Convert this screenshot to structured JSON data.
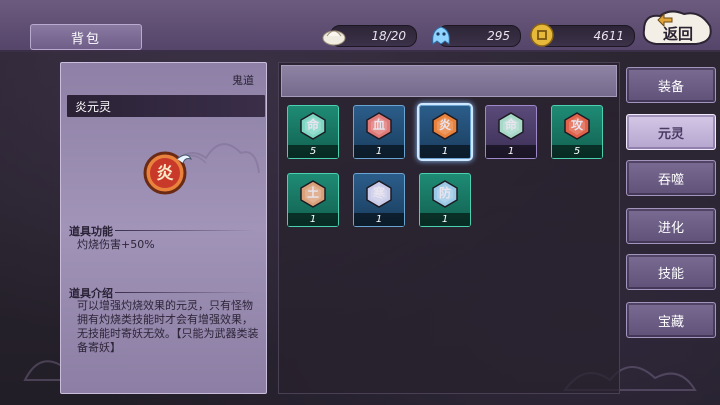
{
  "header": {
    "title": "背包",
    "resources": [
      {
        "name": "bun-icon",
        "value": "18/20"
      },
      {
        "name": "ghost-spirit-icon",
        "value": "295"
      },
      {
        "name": "gold-coin-icon",
        "value": "4611"
      }
    ],
    "back_label": "返回"
  },
  "detail": {
    "category": "鬼道",
    "item_name": "炎元灵",
    "item_glyph": "炎",
    "function_title": "道具功能",
    "function_text": "灼烧伤害+50%",
    "intro_title": "道具介绍",
    "intro_text": "可以增强灼烧效果的元灵，只有怪物拥有灼烧类技能时才会有增强效果，无技能时寄妖无效。【只能为武器类装备寄妖】"
  },
  "inventory": {
    "items": [
      {
        "glyph": "命",
        "count": "5",
        "frame": "teal",
        "gem": "#7fd6c2"
      },
      {
        "glyph": "血",
        "count": "1",
        "frame": "blue",
        "gem": "#e07a78"
      },
      {
        "glyph": "炎",
        "count": "1",
        "frame": "blue",
        "gem": "#e8823c",
        "selected": true
      },
      {
        "glyph": "命",
        "count": "1",
        "frame": "purple",
        "gem": "#a8d8c8"
      },
      {
        "glyph": "攻",
        "count": "5",
        "frame": "teal",
        "gem": "#e0624a"
      },
      {
        "glyph": "土",
        "count": "1",
        "frame": "teal",
        "gem": "#d9a07a"
      },
      {
        "glyph": "寒",
        "count": "1",
        "frame": "blue",
        "gem": "#c9cbe8"
      },
      {
        "glyph": "防",
        "count": "1",
        "frame": "teal",
        "gem": "#9cc9e6"
      }
    ]
  },
  "tabs": [
    {
      "label": "装备",
      "active": false
    },
    {
      "label": "元灵",
      "active": true
    },
    {
      "label": "吞噬",
      "active": false
    },
    {
      "label": "进化",
      "active": false
    },
    {
      "label": "技能",
      "active": false
    },
    {
      "label": "宝藏",
      "active": false
    }
  ],
  "colors": {
    "accent_purple": "#6c5b7e",
    "teal_frame": "#1e8b75",
    "blue_frame": "#2b5d8a",
    "purple_frame": "#5a4a7a"
  }
}
